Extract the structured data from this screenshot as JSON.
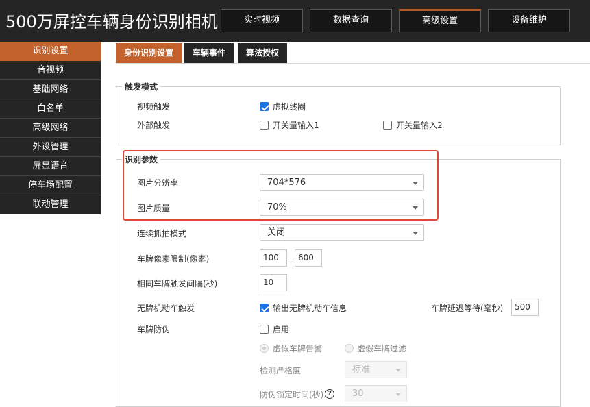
{
  "app": {
    "title": "500万屏控车辆身份识别相机"
  },
  "top_tabs": [
    {
      "label": "实时视频"
    },
    {
      "label": "数据查询"
    },
    {
      "label": "高级设置"
    },
    {
      "label": "设备维护"
    }
  ],
  "sidebar": {
    "items": [
      {
        "label": "识别设置"
      },
      {
        "label": "音视频"
      },
      {
        "label": "基础网络"
      },
      {
        "label": "白名单"
      },
      {
        "label": "高级网络"
      },
      {
        "label": "外设管理"
      },
      {
        "label": "屏显语音"
      },
      {
        "label": "停车场配置"
      },
      {
        "label": "联动管理"
      }
    ]
  },
  "subtabs": [
    {
      "label": "身份识别设置"
    },
    {
      "label": "车辆事件"
    },
    {
      "label": "算法授权"
    }
  ],
  "trigger": {
    "legend": "触发模式",
    "video_label": "视频触发",
    "virtual_coil": {
      "label": "虚拟线圈",
      "checked": true
    },
    "external_label": "外部触发",
    "switch_in1": {
      "label": "开关量输入1",
      "checked": false
    },
    "switch_in2": {
      "label": "开关量输入2",
      "checked": false
    }
  },
  "recognition": {
    "legend": "识别参数",
    "resolution_label": "图片分辨率",
    "resolution_value": "704*576",
    "quality_label": "图片质量",
    "quality_value": "70%",
    "continuous_label": "连续抓拍模式",
    "continuous_value": "关闭",
    "pixel_limit_label": "车牌像素限制(像素)",
    "pixel_min": "100",
    "pixel_sep": "-",
    "pixel_max": "600",
    "same_plate_label": "相同车牌触发间隔(秒)",
    "same_plate_value": "10",
    "no_plate_label": "无牌机动车触发",
    "no_plate_output": {
      "label": "输出无牌机动车信息",
      "checked": true
    },
    "delay_label": "车牌延迟等待(毫秒)",
    "delay_value": "500",
    "anti_fake_label": "车牌防伪",
    "anti_fake_enable": {
      "label": "启用",
      "checked": false
    },
    "fake_alarm": {
      "label": "虚假车牌告警",
      "checked": true
    },
    "fake_filter": {
      "label": "虚假车牌过滤",
      "checked": false
    },
    "strictness_label": "检测严格度",
    "strictness_value": "标准",
    "lock_time_label": "防伪锁定时间(秒)",
    "lock_time_value": "30"
  }
}
